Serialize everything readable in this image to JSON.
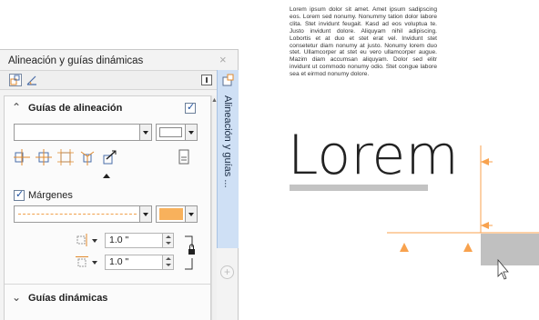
{
  "docker": {
    "title": "Alineación y guías dinámicas",
    "close_glyph": "×",
    "tab_label": "Alineación y guías ...",
    "add_glyph": "+",
    "alignment": {
      "title": "Guías de alineación",
      "collapse_glyph": "⌃",
      "checked": true
    },
    "margins": {
      "label": "Márgenes",
      "checked": true,
      "swatch_color": "#f8b15c",
      "horizontal_value": "1.0 \"",
      "vertical_value": "1.0 \""
    },
    "dynamic": {
      "title": "Guías dinámicas",
      "expand_glyph": "⌄"
    }
  },
  "document": {
    "paragraph": "Lorem ipsum dolor sit amet. Amet ipsum sadipscing eos. Lorem sed nonumy. Nonummy tation dolor labore clita. Stet invidunt feugait. Kasd ad eos voluptua te. Justo invidunt dolore. Aliquyam nihil adipiscing. Lobortis et at duo et stet erat vel. Invidunt stet consetetur diam nonumy at justo. Nonumy lorem duo stet. Ullamcorper at stet eu vero ullamcorper augue. Mazim diam accumsan aliquyam. Dolor sed elitr invidunt ut commodo nonumy odio. Stet congue labore sea et eirmod nonumy dolore.",
    "heading": "Lorem",
    "guide_color": "#f8a24e",
    "underline_color": "#c3c3c3",
    "selection_color": "#c0c0c0"
  }
}
